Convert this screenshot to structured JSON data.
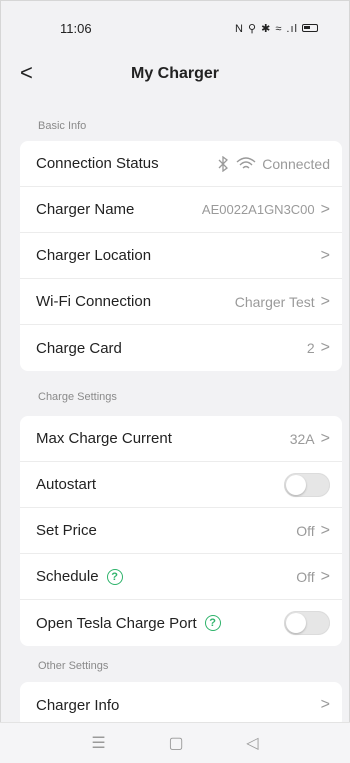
{
  "status": {
    "time": "11:06",
    "icons": "N ⚲ ✱ ≈ .ıl"
  },
  "header": {
    "back": "<",
    "title": "My Charger"
  },
  "basic": {
    "label": "Basic Info",
    "connection": {
      "label": "Connection Status",
      "value": "Connected"
    },
    "name": {
      "label": "Charger Name",
      "value": "AE0022A1GN3C00"
    },
    "location": {
      "label": "Charger Location"
    },
    "wifi": {
      "label": "Wi-Fi Connection",
      "value": "Charger Test"
    },
    "card": {
      "label": "Charge Card",
      "value": "2"
    }
  },
  "charge": {
    "label": "Charge Settings",
    "max": {
      "label": "Max Charge Current",
      "value": "32A"
    },
    "autostart": {
      "label": "Autostart"
    },
    "price": {
      "label": "Set Price",
      "value": "Off"
    },
    "schedule": {
      "label": "Schedule",
      "value": "Off"
    },
    "tesla": {
      "label": "Open Tesla Charge Port"
    }
  },
  "other": {
    "label": "Other Settings",
    "info": {
      "label": "Charger Info"
    }
  },
  "icons": {
    "chevron": ">",
    "help": "?"
  },
  "nav": {
    "menu": "☰",
    "home": "▢",
    "back": "◁"
  }
}
